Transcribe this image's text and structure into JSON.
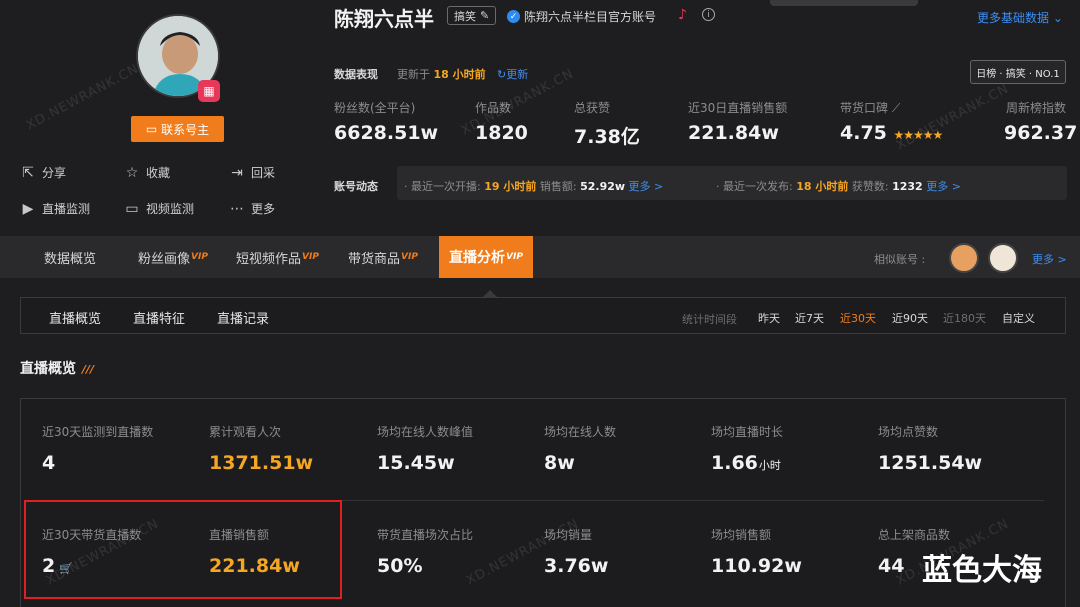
{
  "profile": {
    "name": "陈翔六点半",
    "category_tag": "搞笑",
    "verified_text": "陈翔六点半栏目官方账号",
    "more_basic": "更多基础数据",
    "contact_button": "联系号主",
    "actions": [
      "分享",
      "收藏",
      "回采",
      "直播监测",
      "视频监测",
      "更多"
    ]
  },
  "data_summary": {
    "label": "数据表现",
    "updated_prefix": "更新于",
    "updated_value": "18 小时前",
    "refresh": "更新",
    "rank_badge": "日榜 · 搞笑 · NO.1",
    "stats": [
      {
        "label": "粉丝数(全平台)",
        "value": "6628.51w"
      },
      {
        "label": "作品数",
        "value": "1820"
      },
      {
        "label": "总获赞",
        "value": "7.38亿"
      },
      {
        "label": "近30日直播销售额",
        "value": "221.84w"
      },
      {
        "label": "带货口碑",
        "value": "4.75"
      },
      {
        "label": "周新榜指数",
        "value": "962.37"
      }
    ],
    "rating_stars": "★★★★★"
  },
  "account_dynamics": {
    "label": "账号动态",
    "live_prefix": "最近一次开播:",
    "live_time": "19 小时前",
    "live_sales_label": "销售额:",
    "live_sales_value": "52.92w",
    "more1": "更多 >",
    "post_prefix": "最近一次发布:",
    "post_time": "18 小时前",
    "likes_label": "获赞数:",
    "likes_value": "1232",
    "more2": "更多 >"
  },
  "main_tabs": [
    {
      "label": "数据概览",
      "vip": ""
    },
    {
      "label": "粉丝画像",
      "vip": "VIP"
    },
    {
      "label": "短视频作品",
      "vip": "VIP"
    },
    {
      "label": "带货商品",
      "vip": "VIP"
    },
    {
      "label": "直播分析",
      "vip": "VIP"
    }
  ],
  "similar": {
    "label": "相似账号 :",
    "more": "更多 >"
  },
  "sub_tabs": [
    "直播概览",
    "直播特征",
    "直播记录"
  ],
  "period": {
    "label": "统计时间段",
    "options": [
      "昨天",
      "近7天",
      "近30天",
      "近90天",
      "近180天",
      "自定义"
    ],
    "active": "近30天"
  },
  "section_title": "直播概览",
  "metrics_row1": [
    {
      "label": "近30天监测到直播数",
      "value": "4"
    },
    {
      "label": "累计观看人次",
      "value": "1371.51w"
    },
    {
      "label": "场均在线人数峰值",
      "value": "15.45w"
    },
    {
      "label": "场均在线人数",
      "value": "8w"
    },
    {
      "label": "场均直播时长",
      "value": "1.66",
      "unit": "小时"
    },
    {
      "label": "场均点赞数",
      "value": "1251.54w"
    }
  ],
  "metrics_row2": [
    {
      "label": "近30天带货直播数",
      "value": "2"
    },
    {
      "label": "直播销售额",
      "value": "221.84w"
    },
    {
      "label": "带货直播场次占比",
      "value": "50%"
    },
    {
      "label": "场均销量",
      "value": "3.76w"
    },
    {
      "label": "场均销售额",
      "value": "110.92w"
    },
    {
      "label": "总上架商品数",
      "value": "44"
    }
  ],
  "watermark_text": "XD.NEWRANK.CN",
  "corner_text": "蓝色大海",
  "colors": {
    "accent": "#f07c1c",
    "highlight_value": "#f5a623",
    "link": "#3d8ef0",
    "annotation": "#e02020"
  }
}
